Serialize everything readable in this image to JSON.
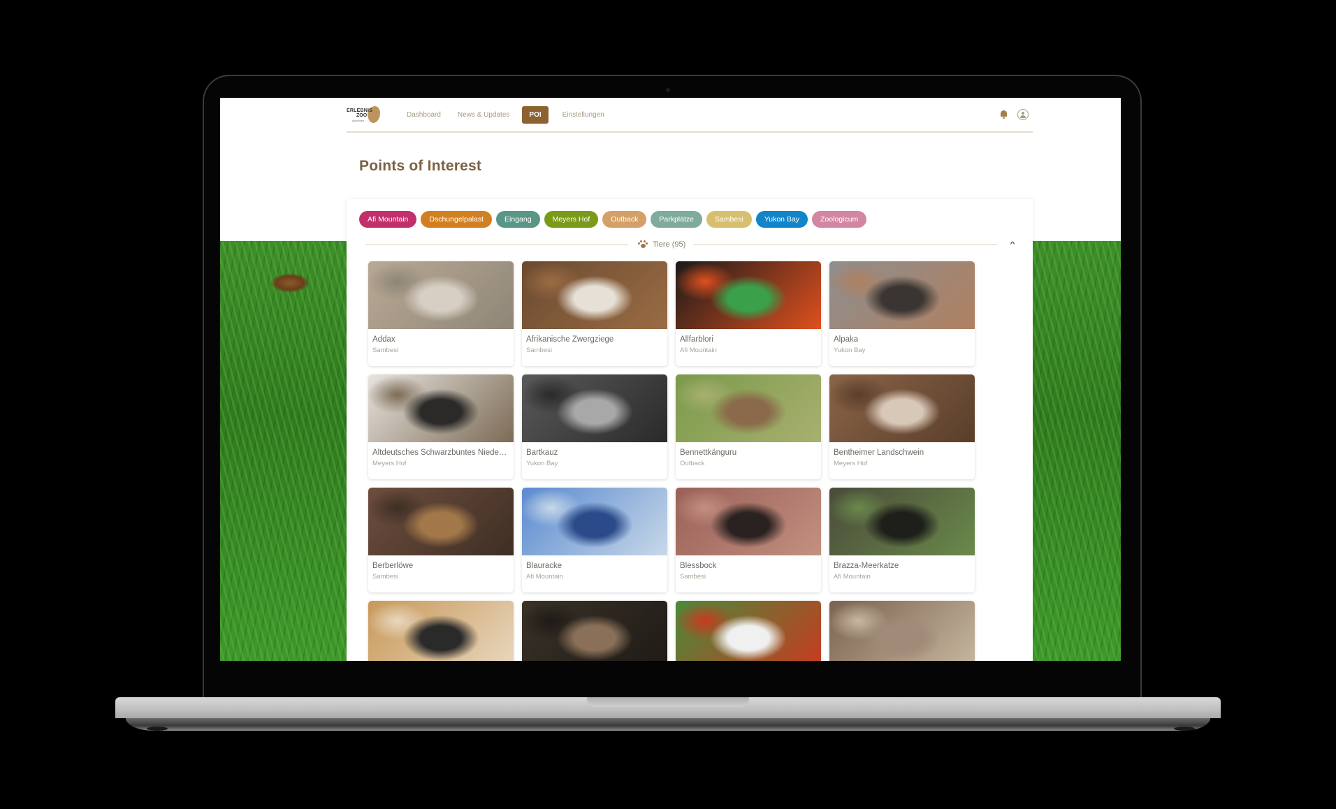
{
  "app": {
    "logo": {
      "line1": "ERLEBNIS",
      "line2": "ZOO",
      "line3": "HANNOVER"
    }
  },
  "nav": {
    "items": [
      {
        "label": "Dashboard",
        "active": false
      },
      {
        "label": "News & Updates",
        "active": false
      },
      {
        "label": "POI",
        "active": true
      },
      {
        "label": "Einstellungen",
        "active": false
      }
    ],
    "icons": [
      "bell-icon",
      "user-account-icon"
    ]
  },
  "page": {
    "title": "Points of Interest"
  },
  "filters": [
    {
      "label": "Afi Mountain",
      "color": "#c1306b"
    },
    {
      "label": "Dschungelpalast",
      "color": "#d2801f"
    },
    {
      "label": "Eingang",
      "color": "#5a9688"
    },
    {
      "label": "Meyers Hof",
      "color": "#7a9a1a"
    },
    {
      "label": "Outback",
      "color": "#d5a068"
    },
    {
      "label": "Parkplätze",
      "color": "#7fab9c"
    },
    {
      "label": "Sambesi",
      "color": "#d7bf6e"
    },
    {
      "label": "Yukon Bay",
      "color": "#1185c8"
    },
    {
      "label": "Zoologicum",
      "color": "#d386a3"
    }
  ],
  "section": {
    "icon": "paw-icon",
    "label": "Tiere (95)",
    "toggle_icon": "chevron-up-icon"
  },
  "animals": [
    {
      "name": "Addax",
      "area": "Sambesi",
      "img": [
        "#b9a994",
        "#d7cfc4",
        "#8f8678"
      ]
    },
    {
      "name": "Afrikanische Zwergziege",
      "area": "Sambesi",
      "img": [
        "#6b4a30",
        "#e7e0d6",
        "#9a6c44"
      ]
    },
    {
      "name": "Allfarblori",
      "area": "Afi Mountain",
      "img": [
        "#1a1a1a",
        "#3aa04a",
        "#e0501f"
      ]
    },
    {
      "name": "Alpaka",
      "area": "Yukon Bay",
      "img": [
        "#8e8e8e",
        "#3a3532",
        "#b08060"
      ]
    },
    {
      "name": "Altdeutsches Schwarzbuntes Niederungsrind",
      "area": "Meyers Hof",
      "img": [
        "#e8e4df",
        "#2b2a28",
        "#7c6b55"
      ]
    },
    {
      "name": "Bartkauz",
      "area": "Yukon Bay",
      "img": [
        "#5a5a5a",
        "#a8a8a8",
        "#2a2a2a"
      ]
    },
    {
      "name": "Bennettkänguru",
      "area": "Outback",
      "img": [
        "#7a9a4a",
        "#8a6a4a",
        "#a8b070"
      ]
    },
    {
      "name": "Bentheimer Landschwein",
      "area": "Meyers Hof",
      "img": [
        "#8a6448",
        "#d8c8b8",
        "#5a3e2a"
      ]
    },
    {
      "name": "Berberlöwe",
      "area": "Sambesi",
      "img": [
        "#6e4e3e",
        "#a2774a",
        "#3e2e24"
      ]
    },
    {
      "name": "Blauracke",
      "area": "Afi Mountain",
      "img": [
        "#5a8ad0",
        "#2a4a8a",
        "#c8d8e8"
      ]
    },
    {
      "name": "Blessbock",
      "area": "Sambesi",
      "img": [
        "#9a6058",
        "#2a2220",
        "#c29080"
      ]
    },
    {
      "name": "Brazza-Meerkatze",
      "area": "Afi Mountain",
      "img": [
        "#4a4a3a",
        "#1e1e1a",
        "#6a8a4a"
      ]
    },
    {
      "name": "",
      "area": "",
      "img": [
        "#c89858",
        "#2a2a2a",
        "#e8d8c0"
      ]
    },
    {
      "name": "",
      "area": "",
      "img": [
        "#3a3228",
        "#8a7058",
        "#1e1a16"
      ]
    },
    {
      "name": "",
      "area": "",
      "img": [
        "#4a8a3a",
        "#f0f0f0",
        "#c83a20"
      ]
    },
    {
      "name": "",
      "area": "",
      "img": [
        "#7a6250",
        "#a08a78",
        "#c8b8a0"
      ]
    }
  ]
}
